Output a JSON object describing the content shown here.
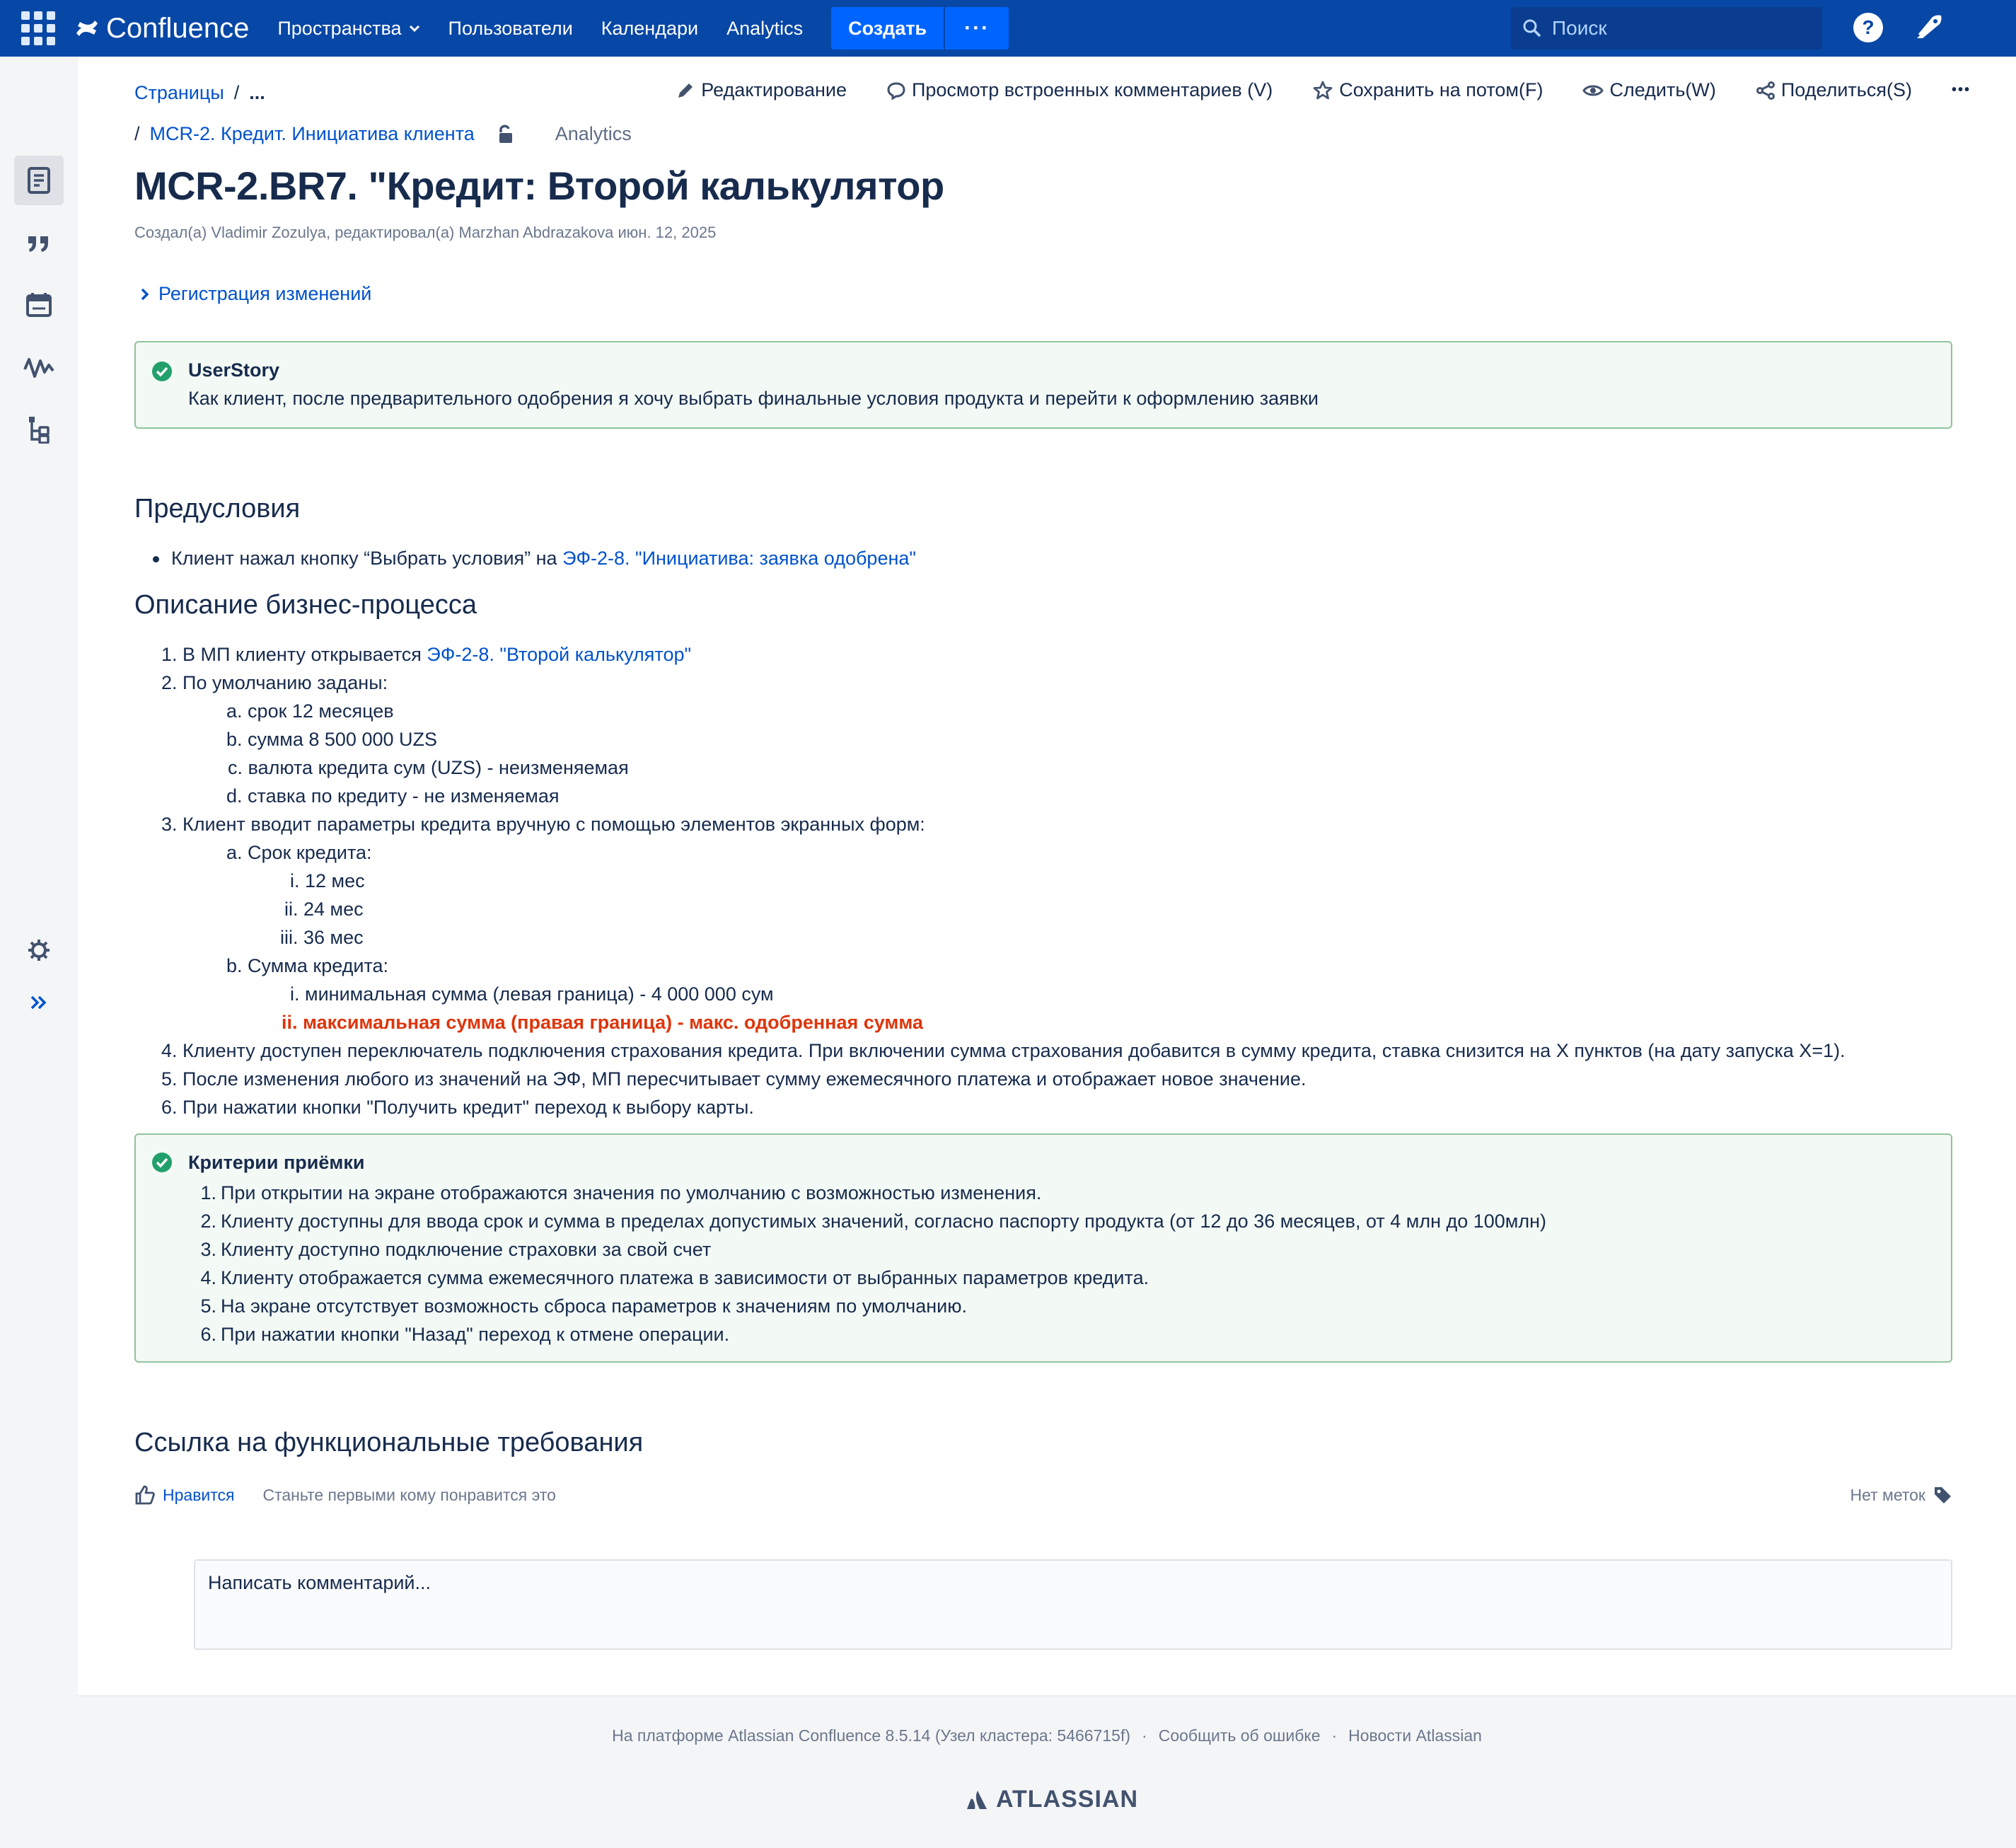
{
  "topnav": {
    "product": "Confluence",
    "links": [
      "Пространства",
      "Пользователи",
      "Календари",
      "Analytics"
    ],
    "create_label": "Создать",
    "more_label": "···",
    "search_placeholder": "Поиск"
  },
  "breadcrumbs": {
    "root": "Страницы",
    "sep": "/",
    "ellipsis": "...",
    "parent": "MCR-2. Кредит. Инициатива клиента",
    "analytics": "Analytics"
  },
  "page_actions": {
    "edit": "Редактирование",
    "comments": "Просмотр встроенных комментариев (V)",
    "save_later": "Сохранить на потом(F)",
    "watch": "Следить(W)",
    "share": "Поделиться(S)",
    "more": "•••"
  },
  "page": {
    "title": "MCR-2.BR7. \"Кредит: Второй калькулятор",
    "byline": "Создал(а) Vladimir Zozulya, редактировал(а) Marzhan Abdrazakova июн. 12, 2025",
    "expand_label": "Регистрация изменений"
  },
  "userstory": {
    "title": "UserStory",
    "text": "Как клиент, после предварительного одобрения я хочу выбрать финальные условия продукта и перейти к оформлению заявки"
  },
  "preconditions": {
    "heading": "Предусловия",
    "item_text": "Клиент нажал кнопку “Выбрать условия” на ",
    "item_link": "ЭФ-2-8. \"Инициатива: заявка одобрена\""
  },
  "process": {
    "heading": "Описание бизнес-процесса",
    "s1_num": "1.",
    "s1_text": "В МП клиенту открывается ",
    "s1_link": "ЭФ-2-8. \"Второй калькулятор\"",
    "s2_num": "2.",
    "s2_text": "По умолчанию заданы:",
    "s2a_num": "a.",
    "s2a_text": "срок 12 месяцев",
    "s2b_num": "b.",
    "s2b_text": "сумма 8 500 000 UZS",
    "s2c_num": "c.",
    "s2c_text": "валюта кредита сум (UZS) - неизменяемая",
    "s2d_num": "d.",
    "s2d_text": "ставка по кредиту - не изменяемая",
    "s3_num": "3.",
    "s3_text": "Клиент вводит параметры кредита вручную с помощью элементов экранных форм:",
    "s3a_num": "a.",
    "s3a_text": "Срок кредита:",
    "s3a1_num": "i.",
    "s3a1_text": "12 мес",
    "s3a2_num": "ii.",
    "s3a2_text": "24 мес",
    "s3a3_num": "iii.",
    "s3a3_text": "36 мес",
    "s3b_num": "b.",
    "s3b_text": "Сумма кредита:",
    "s3b1_num": "i.",
    "s3b1_text": "минимальная сумма (левая граница) - 4 000 000 сум",
    "s3b2_num": "ii.",
    "s3b2_text": "максимальная сумма (правая граница) - макс. одобренная сумма",
    "s4_num": "4.",
    "s4_text": "Клиенту доступен переключатель подключения страхования кредита. При включении сумма страхования добавится в сумму кредита, ставка снизится на Х пунктов (на дату  запуска Х=1).",
    "s5_num": "5.",
    "s5_text": "После изменения любого из значений на ЭФ, МП пересчитывает сумму ежемесячного платежа и отображает новое значение.",
    "s6_num": "6.",
    "s6_text": "При нажатии кнопки \"Получить кредит\" переход к выбору карты."
  },
  "acceptance": {
    "title": "Критерии приёмки",
    "items": [
      {
        "num": "1.",
        "text": "При открытии на экране отображаются значения по умолчанию с возможностью изменения."
      },
      {
        "num": "2.",
        "text": "Клиенту доступны для ввода срок и сумма в пределах допустимых значений, согласно паспорту продукта (от 12 до 36 месяцев, от 4 млн до 100млн)"
      },
      {
        "num": "3.",
        "text": "Клиенту доступно подключение страховки за свой счет"
      },
      {
        "num": "4.",
        "text": "Клиенту отображается сумма ежемесячного платежа в зависимости от выбранных параметров кредита."
      },
      {
        "num": "5.",
        "text": "На экране отсутствует возможность сброса параметров к значениям по умолчанию."
      },
      {
        "num": "6.",
        "text": "При нажатии кнопки \"Назад\" переход к отмене операции."
      }
    ]
  },
  "func_req": {
    "heading": "Ссылка на функциональные требования"
  },
  "likes": {
    "like_label": "Нравится",
    "first_text": "Станьте первыми кому понравится это",
    "labels_text": "Нет меток"
  },
  "comment": {
    "placeholder": "Написать комментарий..."
  },
  "footer": {
    "platform": "На платформе Atlassian Confluence 8.5.14 (Узел кластера: 5466715f)",
    "dot": "·",
    "report": "Сообщить об ошибке",
    "news": "Новости Atlassian",
    "brand": "ATLASSIAN"
  },
  "colors": {
    "nav_bg": "#0747a6",
    "create_btn": "#0065ff",
    "link": "#0052cc",
    "panel_bg": "#f3f9f4",
    "panel_border": "#8fc49c",
    "success_icon": "#22a06b",
    "highlight_red": "#de350b"
  },
  "icons": [
    "app-switcher-icon",
    "confluence-logo-icon",
    "chevron-down-icon",
    "search-icon",
    "help-icon",
    "notification-icon",
    "pages-icon",
    "blog-icon",
    "calendar-icon",
    "analytics-icon",
    "page-tree-icon",
    "settings-icon",
    "expand-sidebar-icon",
    "pencil-icon",
    "comment-icon",
    "star-icon",
    "eye-icon",
    "share-icon",
    "chevron-right-icon",
    "unlock-icon",
    "check-circle-icon",
    "thumbs-up-icon",
    "tag-icon",
    "atlassian-logo-icon"
  ]
}
